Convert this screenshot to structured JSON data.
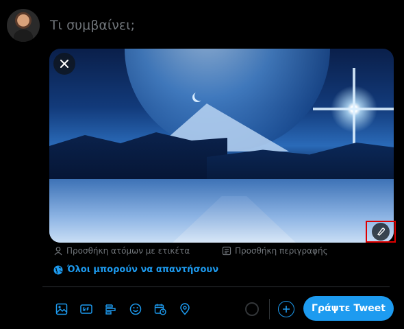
{
  "compose": {
    "placeholder": "Τι συμβαίνει;"
  },
  "media": {
    "edit_highlight_color": "#e00000"
  },
  "media_meta": {
    "tag_people": "Προσθήκη ατόμων με ετικέτα",
    "add_description": "Προσθήκη περιγραφής"
  },
  "reply_setting": {
    "label": "Όλοι μπορούν να απαντήσουν"
  },
  "toolbar": {
    "icons": [
      "image-icon",
      "gif-icon",
      "poll-icon",
      "emoji-icon",
      "schedule-icon",
      "location-icon"
    ],
    "tweet_label": "Γράψτε Tweet",
    "accent": "#1d9bf0"
  }
}
